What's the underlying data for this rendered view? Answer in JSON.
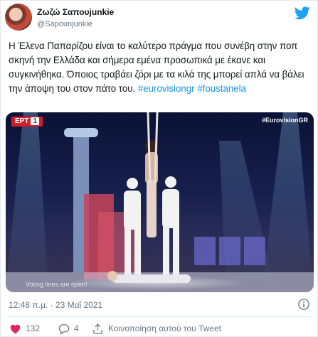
{
  "author": {
    "display_name": "Ζωζώ Σαπουjunkie",
    "handle": "@Sapounjunkie"
  },
  "tweet": {
    "text_main": "Η Έλενα Παπαρίζου είναι το καλύτερο πράγμα που συνέβη στην ποπ σκηνή την Ελλάδα και σήμερα εμένα προσωπικά με έκανε και συγκινήθηκα. Όποιος τραβάει ζόρι με τα κιλά της μπορεί απλά να βάλει την άποψη του στον πάτο του. ",
    "hashtag_1": "#eurovisiongr",
    "hashtag_2": "#foustanela"
  },
  "media": {
    "channel_logo": "ΕΡΤ",
    "channel_number": "1",
    "overlay_hashtag": "#EurovisionGR",
    "overlay_caption": "Voting lines are open!"
  },
  "meta": {
    "timestamp": "12:48 π.μ. · 23 Μαΐ 2021"
  },
  "actions": {
    "likes": "132",
    "replies": "4",
    "share_label": "Κοινοποίηση αυτού του Tweet"
  },
  "colors": {
    "accent": "#1b95e0",
    "like_red": "#e0245e",
    "text_secondary": "#657786"
  },
  "icons": [
    "twitter-bird-icon",
    "info-icon",
    "heart-icon",
    "reply-bubble-icon",
    "share-icon"
  ]
}
